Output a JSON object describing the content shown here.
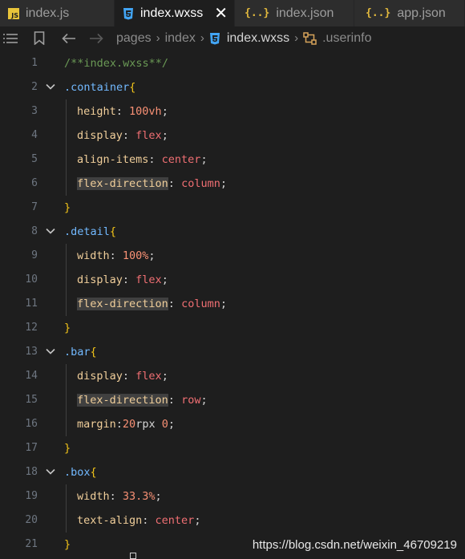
{
  "tabs": [
    {
      "icon": "js-file-icon",
      "icon_text": "JS",
      "label": "index.js",
      "active": false
    },
    {
      "icon": "css-file-icon",
      "icon_text": "",
      "label": "index.wxss",
      "active": true
    },
    {
      "icon": "json-file-icon",
      "icon_text": "{..}",
      "label": "index.json",
      "active": false
    },
    {
      "icon": "json-file-icon",
      "icon_text": "{..}",
      "label": "app.json",
      "active": false
    }
  ],
  "breadcrumb": {
    "parts": [
      "pages",
      "index",
      "index.wxss",
      ".userinfo"
    ]
  },
  "code_lines": [
    {
      "n": "1",
      "fold": false,
      "indent": 0,
      "tokens": [
        {
          "t": "comment",
          "v": "/**index.wxss**/"
        }
      ]
    },
    {
      "n": "2",
      "fold": true,
      "indent": 0,
      "tokens": [
        {
          "t": "selector",
          "v": ".container"
        },
        {
          "t": "brace",
          "v": "{"
        }
      ]
    },
    {
      "n": "3",
      "fold": false,
      "indent": 1,
      "tokens": [
        {
          "t": "prop",
          "v": "height"
        },
        {
          "t": "punct",
          "v": ": "
        },
        {
          "t": "num",
          "v": "100vh"
        },
        {
          "t": "punct",
          "v": ";"
        }
      ]
    },
    {
      "n": "4",
      "fold": false,
      "indent": 1,
      "tokens": [
        {
          "t": "prop",
          "v": "display"
        },
        {
          "t": "punct",
          "v": ": "
        },
        {
          "t": "value",
          "v": "flex"
        },
        {
          "t": "punct",
          "v": ";"
        }
      ]
    },
    {
      "n": "5",
      "fold": false,
      "indent": 1,
      "tokens": [
        {
          "t": "prop",
          "v": "align-items"
        },
        {
          "t": "punct",
          "v": ": "
        },
        {
          "t": "value",
          "v": "center"
        },
        {
          "t": "punct",
          "v": ";"
        }
      ]
    },
    {
      "n": "6",
      "fold": false,
      "indent": 1,
      "tokens": [
        {
          "t": "prop",
          "v": "flex-direction",
          "hl": true
        },
        {
          "t": "punct",
          "v": ": "
        },
        {
          "t": "value",
          "v": "column"
        },
        {
          "t": "punct",
          "v": ";"
        }
      ]
    },
    {
      "n": "7",
      "fold": false,
      "indent": 0,
      "tokens": [
        {
          "t": "brace",
          "v": "}"
        }
      ]
    },
    {
      "n": "8",
      "fold": true,
      "indent": 0,
      "tokens": [
        {
          "t": "selector",
          "v": ".detail"
        },
        {
          "t": "brace",
          "v": "{"
        }
      ]
    },
    {
      "n": "9",
      "fold": false,
      "indent": 1,
      "tokens": [
        {
          "t": "prop",
          "v": "width"
        },
        {
          "t": "punct",
          "v": ": "
        },
        {
          "t": "num",
          "v": "100%"
        },
        {
          "t": "punct",
          "v": ";"
        }
      ]
    },
    {
      "n": "10",
      "fold": false,
      "indent": 1,
      "tokens": [
        {
          "t": "prop",
          "v": "display"
        },
        {
          "t": "punct",
          "v": ": "
        },
        {
          "t": "value",
          "v": "flex"
        },
        {
          "t": "punct",
          "v": ";"
        }
      ]
    },
    {
      "n": "11",
      "fold": false,
      "indent": 1,
      "tokens": [
        {
          "t": "prop",
          "v": "flex-direction",
          "hl": true
        },
        {
          "t": "punct",
          "v": ": "
        },
        {
          "t": "value",
          "v": "column"
        },
        {
          "t": "punct",
          "v": ";"
        }
      ]
    },
    {
      "n": "12",
      "fold": false,
      "indent": 0,
      "tokens": [
        {
          "t": "brace",
          "v": "}"
        }
      ]
    },
    {
      "n": "13",
      "fold": true,
      "indent": 0,
      "tokens": [
        {
          "t": "selector",
          "v": ".bar"
        },
        {
          "t": "brace",
          "v": "{"
        }
      ]
    },
    {
      "n": "14",
      "fold": false,
      "indent": 1,
      "tokens": [
        {
          "t": "prop",
          "v": "display"
        },
        {
          "t": "punct",
          "v": ": "
        },
        {
          "t": "value",
          "v": "flex"
        },
        {
          "t": "punct",
          "v": ";"
        }
      ]
    },
    {
      "n": "15",
      "fold": false,
      "indent": 1,
      "tokens": [
        {
          "t": "prop",
          "v": "flex-direction",
          "hl": true
        },
        {
          "t": "punct",
          "v": ": "
        },
        {
          "t": "value",
          "v": "row"
        },
        {
          "t": "punct",
          "v": ";"
        }
      ]
    },
    {
      "n": "16",
      "fold": false,
      "indent": 1,
      "tokens": [
        {
          "t": "prop",
          "v": "margin"
        },
        {
          "t": "punct",
          "v": ":"
        },
        {
          "t": "num",
          "v": "20"
        },
        {
          "t": "punct",
          "v": "rpx "
        },
        {
          "t": "num",
          "v": "0"
        },
        {
          "t": "punct",
          "v": ";"
        }
      ]
    },
    {
      "n": "17",
      "fold": false,
      "indent": 0,
      "tokens": [
        {
          "t": "brace",
          "v": "}"
        }
      ]
    },
    {
      "n": "18",
      "fold": true,
      "indent": 0,
      "tokens": [
        {
          "t": "selector",
          "v": ".box"
        },
        {
          "t": "brace",
          "v": "{"
        }
      ]
    },
    {
      "n": "19",
      "fold": false,
      "indent": 1,
      "tokens": [
        {
          "t": "prop",
          "v": "width"
        },
        {
          "t": "punct",
          "v": ": "
        },
        {
          "t": "num",
          "v": "33.3%"
        },
        {
          "t": "punct",
          "v": ";"
        }
      ]
    },
    {
      "n": "20",
      "fold": false,
      "indent": 1,
      "tokens": [
        {
          "t": "prop",
          "v": "text-align"
        },
        {
          "t": "punct",
          "v": ": "
        },
        {
          "t": "value",
          "v": "center"
        },
        {
          "t": "punct",
          "v": ";"
        }
      ]
    },
    {
      "n": "21",
      "fold": false,
      "indent": 0,
      "tokens": [
        {
          "t": "brace",
          "v": "}"
        }
      ]
    }
  ],
  "watermark": "https://blog.csdn.net/weixin_46709219",
  "colors": {
    "background": "#1e1e1e",
    "tab_inactive": "#2d2d2d",
    "comment": "#6a9955",
    "selector": "#72b9ff",
    "brace": "#f2c419",
    "property": "#f0ce9a",
    "value": "#f06f73",
    "number": "#f99175"
  }
}
